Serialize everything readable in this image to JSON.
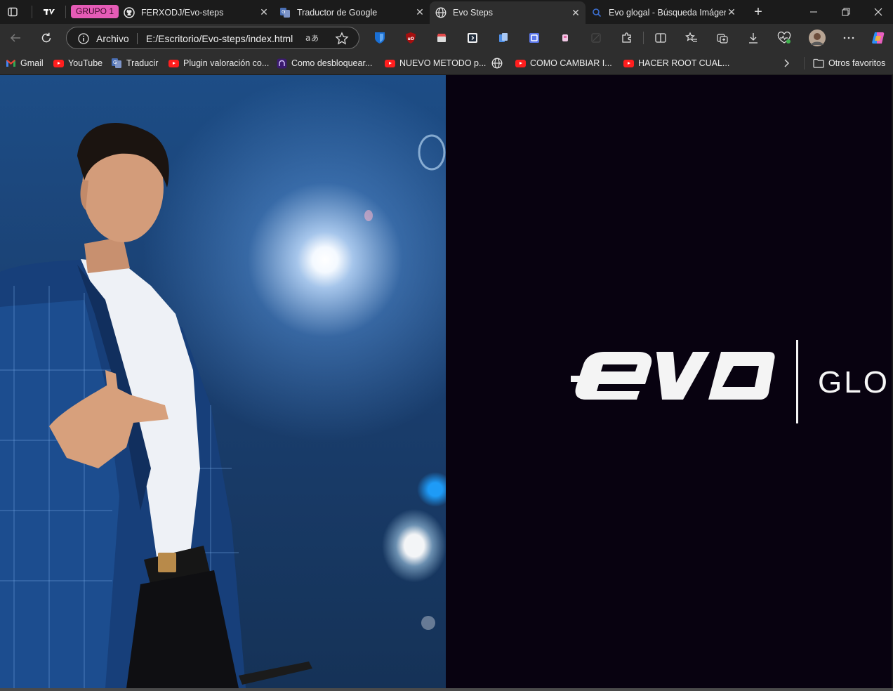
{
  "tabbar": {
    "group_label": "GRUPO 1",
    "tabs": [
      {
        "title": "FERXODJ/Evo-steps",
        "icon": "github-icon"
      },
      {
        "title": "Traductor de Google",
        "icon": "google-translate-icon"
      },
      {
        "title": "Evo Steps",
        "icon": "globe-icon",
        "active": true
      },
      {
        "title": "Evo glogal - Búsqueda Imágenes",
        "icon": "search-icon"
      }
    ]
  },
  "address_bar": {
    "scheme_label": "Archivo",
    "url": "E:/Escritorio/Evo-steps/index.html"
  },
  "bookmarks": [
    {
      "label": "Gmail",
      "icon": "gmail-icon"
    },
    {
      "label": "YouTube",
      "icon": "youtube-icon"
    },
    {
      "label": "Traducir",
      "icon": "google-translate-icon"
    },
    {
      "label": "Plugin valoración co...",
      "icon": "youtube-icon"
    },
    {
      "label": "Como desbloquear...",
      "icon": "podcast-icon"
    },
    {
      "label": "NUEVO METODO p...",
      "icon": "youtube-icon"
    },
    {
      "label": "",
      "icon": "globe-icon"
    },
    {
      "label": "COMO CAMBIAR I...",
      "icon": "youtube-icon"
    },
    {
      "label": "HACER ROOT CUAL...",
      "icon": "youtube-icon"
    }
  ],
  "other_bookmarks": "Otros favoritos",
  "page": {
    "logo_text": "GLO",
    "logo_mark": "evo"
  },
  "colors": {
    "page_background": "#080210",
    "group_chip": "#e55bb6",
    "browser_chrome": "#2e2e2e"
  }
}
